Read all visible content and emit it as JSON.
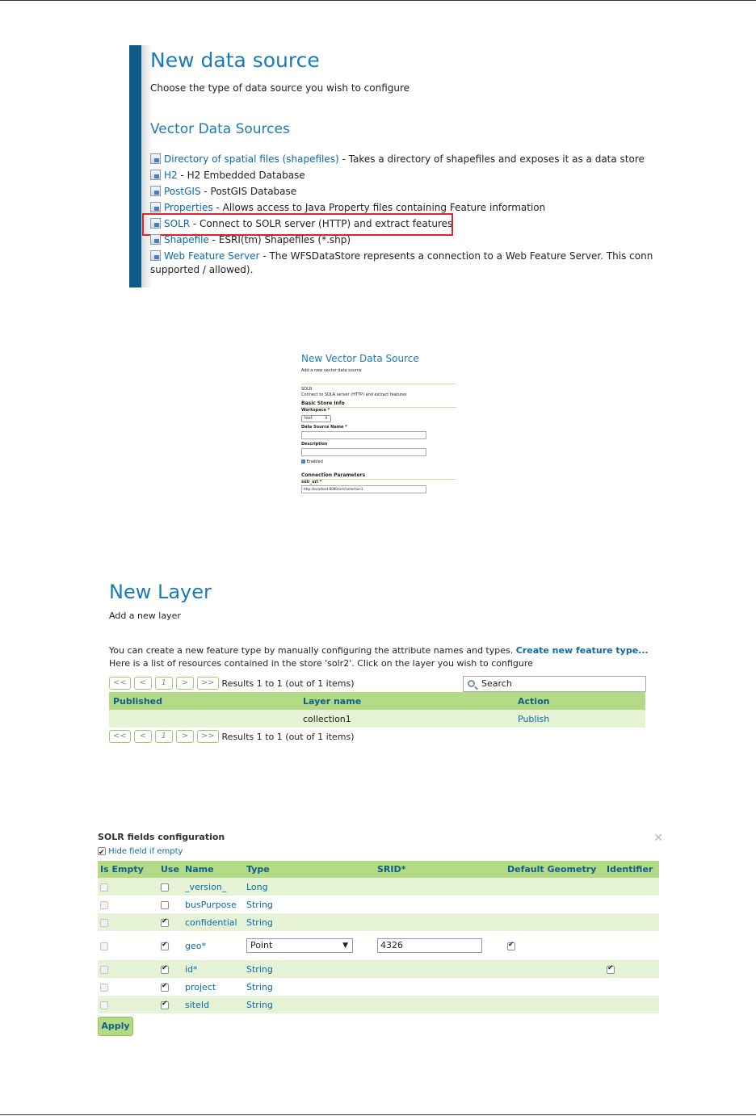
{
  "section1": {
    "title": "New data source",
    "subtitle": "Choose the type of data source you wish to configure",
    "group_title": "Vector Data Sources",
    "sources": [
      {
        "name": "Directory of spatial files (shapefiles)",
        "desc": " - Takes a directory of shapefiles and exposes it as a data store",
        "icon": "datastore-icon"
      },
      {
        "name": "H2",
        "desc": " - H2 Embedded Database",
        "icon": "datastore-icon"
      },
      {
        "name": "PostGIS",
        "desc": " - PostGIS Database",
        "icon": "datastore-icon"
      },
      {
        "name": "Properties",
        "desc": " - Allows access to Java Property files containing Feature information",
        "icon": "datastore-icon"
      },
      {
        "name": "SOLR",
        "desc": " - Connect to SOLR server (HTTP) and extract features",
        "icon": "datastore-icon",
        "highlighted": true
      },
      {
        "name": "Shapefile",
        "desc": " - ESRI(tm) Shapefiles (*.shp)",
        "icon": "datastore-icon"
      },
      {
        "name": "Web Feature Server",
        "desc": " - The WFSDataStore represents a connection to a Web Feature Server. This conn",
        "icon": "wfs-icon"
      }
    ],
    "tail": "supported / allowed).",
    "highlight_color": "#e0252a"
  },
  "section2": {
    "title": "New Vector Data Source",
    "subtitle": "Add a new vector data source",
    "type_name": "SOLR",
    "type_desc": "Connect to SOLR server (HTTP) and extract features",
    "basic_title": "Basic Store Info",
    "workspace_label": "Workspace *",
    "workspace_value": "test",
    "name_label": "Data Source Name *",
    "desc_label": "Description",
    "enabled_label": "Enabled",
    "conn_title": "Connection Parameters",
    "url_label": "solr_url *",
    "url_value": "http://localhost:8080/solr/collection1"
  },
  "section3": {
    "title": "New Layer",
    "subtitle": "Add a new layer",
    "intro_line1": "You can create a new feature type by manually configuring the attribute names and types. ",
    "create_link": "Create new feature type...",
    "intro_line2": "Here is a list of resources contained in the store 'solr2'. Click on the layer you wish to configure",
    "pager": {
      "first": "<<",
      "prev": "<",
      "page": "1",
      "next": ">",
      "last": ">>",
      "results": "Results 1 to 1 (out of 1 items)"
    },
    "search_placeholder": "Search",
    "columns": [
      "Published",
      "Layer name",
      "Action"
    ],
    "rows": [
      {
        "published": "",
        "layer": "collection1",
        "action": "Publish"
      }
    ]
  },
  "section4": {
    "title": "SOLR fields configuration",
    "hide_label": "Hide field if empty",
    "columns": [
      "Is Empty",
      "Use",
      "Name",
      "Type",
      "SRID*",
      "Default Geometry",
      "Identifier"
    ],
    "rows": [
      {
        "name": "_version_",
        "type": "Long",
        "use": false,
        "identifier": false
      },
      {
        "name": "busPurpose",
        "type": "String",
        "use": false,
        "identifier": false
      },
      {
        "name": "confidential",
        "type": "String",
        "use": true,
        "identifier": false
      },
      {
        "name": "geo*",
        "type": "Point",
        "use": true,
        "srid": "4326",
        "default_geometry": true,
        "identifier": false
      },
      {
        "name": "id*",
        "type": "String",
        "use": true,
        "identifier": true
      },
      {
        "name": "project",
        "type": "String",
        "use": true,
        "identifier": false
      },
      {
        "name": "siteId",
        "type": "String",
        "use": true,
        "identifier": false
      }
    ],
    "apply_label": "Apply"
  },
  "colors": {
    "accent": "#1a7bb9",
    "header_green": "#b3da84",
    "row_green": "#e6f2d5",
    "link": "#0b6aa8"
  }
}
